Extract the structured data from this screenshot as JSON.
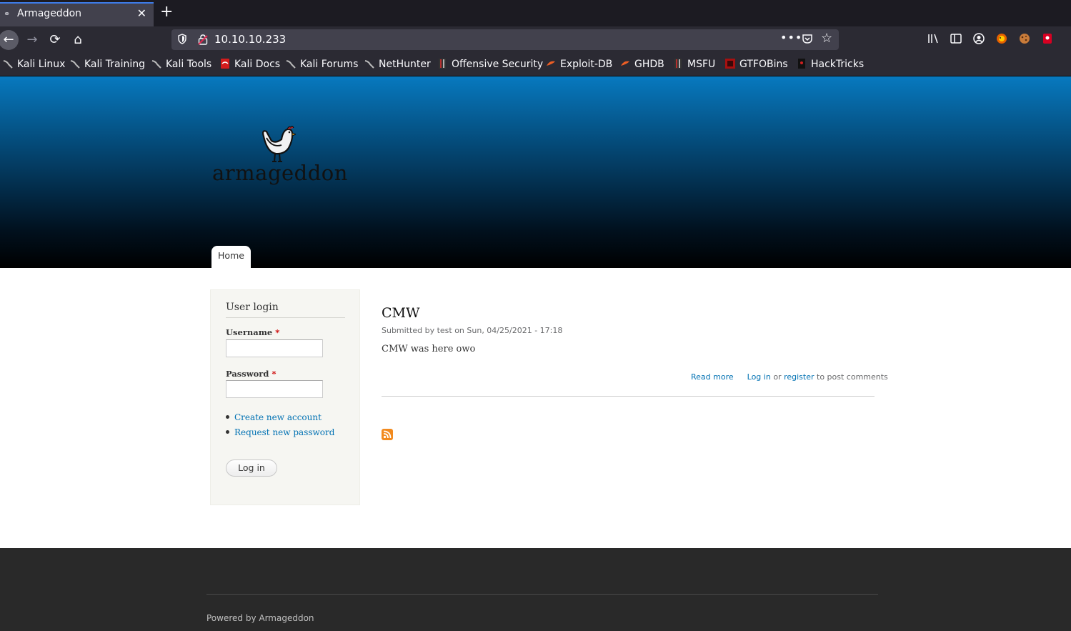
{
  "browser": {
    "tab": {
      "title": "Armageddon",
      "favicon": "drupal-icon"
    },
    "url": "10.10.10.233",
    "bookmarks": [
      {
        "label": "Kali Linux",
        "icon": "kali-dragon-icon"
      },
      {
        "label": "Kali Training",
        "icon": "kali-dragon-icon"
      },
      {
        "label": "Kali Tools",
        "icon": "kali-dragon-icon"
      },
      {
        "label": "Kali Docs",
        "icon": "kali-docs-icon"
      },
      {
        "label": "Kali Forums",
        "icon": "kali-dragon-icon"
      },
      {
        "label": "NetHunter",
        "icon": "kali-dragon-icon"
      },
      {
        "label": "Offensive Security",
        "icon": "offsec-icon"
      },
      {
        "label": "Exploit-DB",
        "icon": "exploitdb-icon"
      },
      {
        "label": "GHDB",
        "icon": "exploitdb-icon"
      },
      {
        "label": "MSFU",
        "icon": "offsec-icon"
      },
      {
        "label": "GTFOBins",
        "icon": "gtfobins-icon"
      },
      {
        "label": "HackTricks",
        "icon": "hacktricks-icon"
      }
    ]
  },
  "site": {
    "name": "armageddon",
    "nav_home": "Home"
  },
  "login": {
    "title": "User login",
    "username_label": "Username",
    "password_label": "Password",
    "required_mark": "*",
    "username_value": "",
    "password_value": "",
    "links": [
      "Create new account",
      "Request new password"
    ],
    "submit": "Log in"
  },
  "article": {
    "title": "CMW",
    "meta": "Submitted by test on Sun, 04/25/2021 - 17:18",
    "body": "CMW was here owo",
    "read_more": "Read more",
    "login_link": "Log in",
    "or_text": "or",
    "register_link": "register",
    "post_comments": "to post comments"
  },
  "footer": {
    "powered": "Powered by Armageddon"
  },
  "colors": {
    "link": "#0071b3",
    "header_top": "#0779bf",
    "footer_bg": "#292929"
  }
}
